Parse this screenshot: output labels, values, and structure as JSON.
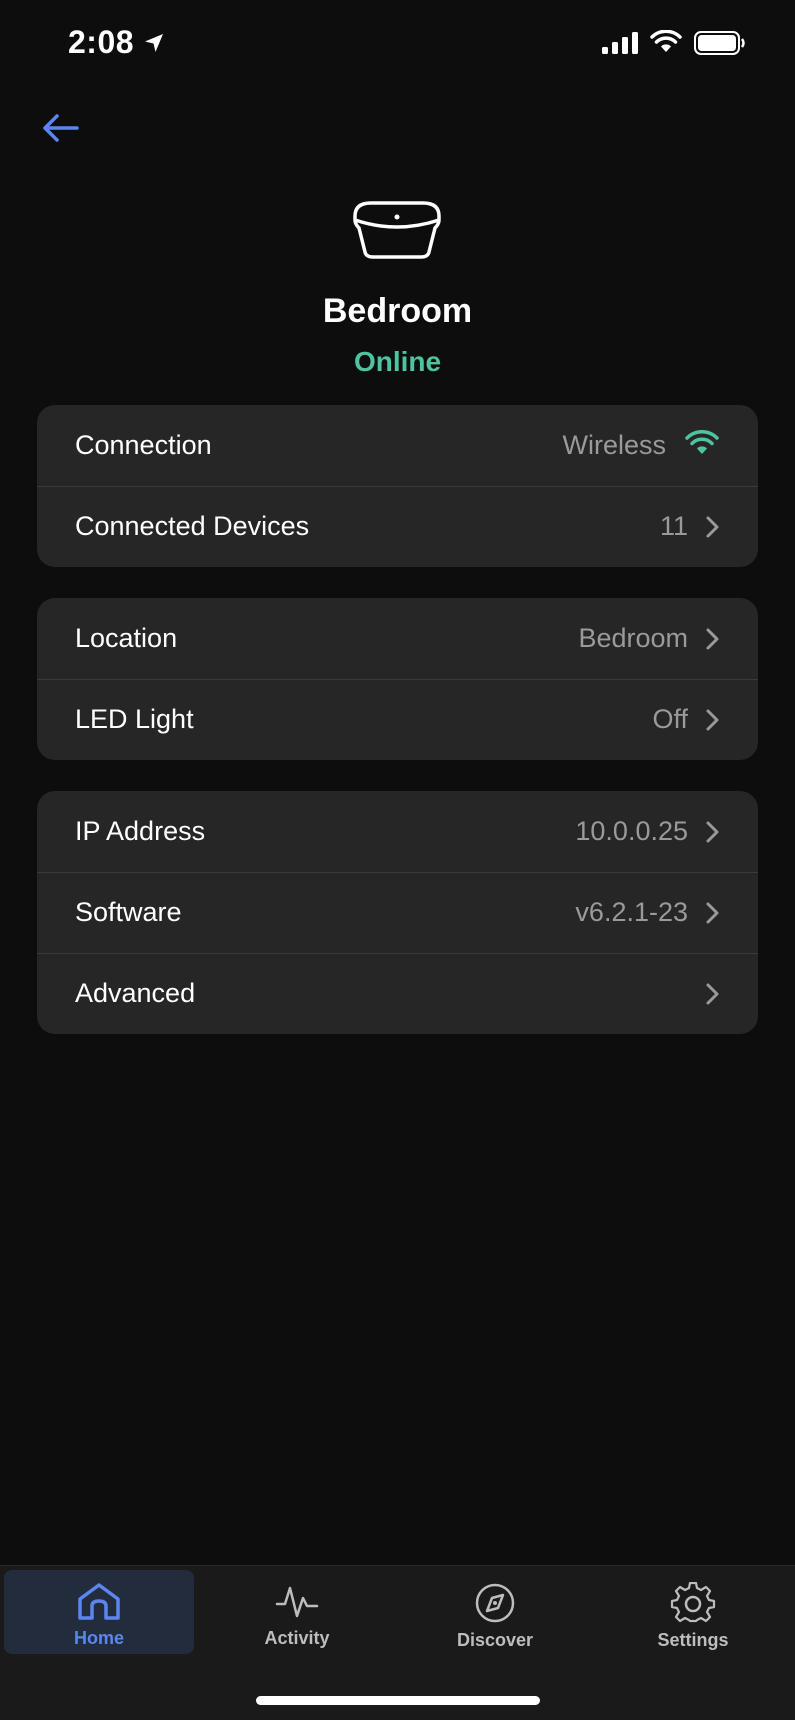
{
  "status_bar": {
    "time": "2:08"
  },
  "colors": {
    "accent": "#5b86f0",
    "online": "#4fc3a1",
    "card": "#262626",
    "background": "#0d0d0d"
  },
  "device": {
    "name": "Bedroom",
    "status": "Online"
  },
  "groups": [
    {
      "rows": [
        {
          "label": "Connection",
          "value": "Wireless",
          "icon": "wifi-icon"
        },
        {
          "label": "Connected Devices",
          "value": "11",
          "icon": "chevron-right-icon"
        }
      ]
    },
    {
      "rows": [
        {
          "label": "Location",
          "value": "Bedroom",
          "icon": "chevron-right-icon"
        },
        {
          "label": "LED Light",
          "value": "Off",
          "icon": "chevron-right-icon"
        }
      ]
    },
    {
      "rows": [
        {
          "label": "IP Address",
          "value": "10.0.0.25",
          "icon": "chevron-right-icon"
        },
        {
          "label": "Software",
          "value": "v6.2.1-23",
          "icon": "chevron-right-icon"
        },
        {
          "label": "Advanced",
          "value": "",
          "icon": "chevron-right-icon"
        }
      ]
    }
  ],
  "tabs": [
    {
      "label": "Home",
      "icon": "home-icon",
      "active": true
    },
    {
      "label": "Activity",
      "icon": "activity-icon",
      "active": false
    },
    {
      "label": "Discover",
      "icon": "compass-icon",
      "active": false
    },
    {
      "label": "Settings",
      "icon": "gear-icon",
      "active": false
    }
  ]
}
